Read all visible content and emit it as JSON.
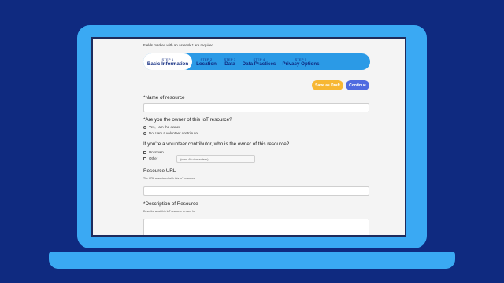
{
  "form": {
    "required_note": "Fields marked with an asterisk * are required",
    "steps": [
      {
        "num": "STEP 1",
        "title": "Basic Information"
      },
      {
        "num": "STEP 2",
        "title": "Location"
      },
      {
        "num": "STEP 3",
        "title": "Data"
      },
      {
        "num": "STEP 4",
        "title": "Data Practices"
      },
      {
        "num": "STEP 5",
        "title": "Privacy Options"
      }
    ],
    "save_draft_label": "Save as Draft",
    "continue_label": "Continue",
    "name_label": "*Name of resource",
    "owner_question": "*Are you the owner of this IoT resource?",
    "owner_yes": "Yes, I am the owner",
    "owner_no": "No, I am a volunteer contributor",
    "volunteer_question": "If you're a volunteer contributor, who is the owner of this resource?",
    "unknown_label": "Unknown",
    "other_label": "Other",
    "other_placeholder": "(max 40 characters)",
    "url_label": "Resource URL",
    "url_help": "The URL associated with this IoT resource",
    "description_label": "*Description of Resource",
    "description_help": "Describe what this IoT resource is used for"
  }
}
